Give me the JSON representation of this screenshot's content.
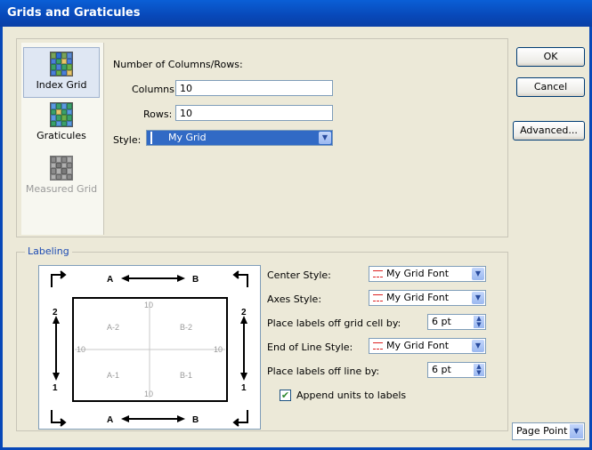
{
  "window": {
    "title": "Grids and Graticules"
  },
  "tabs": [
    {
      "label": "Index Grid",
      "state": "active"
    },
    {
      "label": "Graticules",
      "state": "normal"
    },
    {
      "label": "Measured Grid",
      "state": "disabled"
    }
  ],
  "index_grid": {
    "heading": "Number of Columns/Rows:",
    "columns_label": "Columns:",
    "columns_value": "10",
    "rows_label": "Rows:",
    "rows_value": "10",
    "style_label": "Style:",
    "style_value": "My Grid"
  },
  "buttons": {
    "ok": "OK",
    "cancel": "Cancel",
    "advanced": "Advanced..."
  },
  "labeling": {
    "title": "Labeling",
    "center_style_label": "Center Style:",
    "center_style_value": "My Grid Font",
    "axes_style_label": "Axes Style:",
    "axes_style_value": "My Grid Font",
    "place_cell_label": "Place labels off grid cell by:",
    "place_cell_value": "6 pt",
    "end_line_style_label": "End of Line Style:",
    "end_line_style_value": "My Grid Font",
    "place_line_label": "Place labels off line by:",
    "place_line_value": "6 pt",
    "append_units_label": "Append units to labels",
    "append_units_checked": true
  },
  "diagram": {
    "top_a": "A",
    "top_b": "B",
    "bottom_a": "A",
    "bottom_b": "B",
    "left_top": "2",
    "left_bottom": "1",
    "right_top": "2",
    "right_bottom": "1",
    "cell_a2": "A-2",
    "cell_b2": "B-2",
    "cell_a1": "A-1",
    "cell_b1": "B-1",
    "tick_top": "10",
    "tick_bottom": "10",
    "tick_left": "10",
    "tick_right": "10"
  },
  "units": {
    "value": "Page Point"
  },
  "colors": {
    "titlebar": "#0848b8",
    "accent": "#316ac5"
  }
}
